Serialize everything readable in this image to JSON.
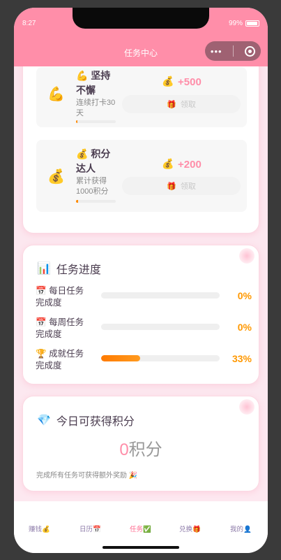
{
  "status": {
    "time": "8:27",
    "battery": "99%"
  },
  "navbar": {
    "title": "任务中心",
    "capsule_more": "•••",
    "capsule_close_icon": "target-icon"
  },
  "achievements": [
    {
      "icon": "💪",
      "emoji": "💪",
      "name": "坚持不懈",
      "desc": "连续打卡30天",
      "progress": 0.03,
      "reward_icon": "💰",
      "points": "+500",
      "claim_icon": "🎁",
      "claim": "领取"
    },
    {
      "icon": "💰",
      "emoji": "💰",
      "name": "积分达人",
      "desc": "累计获得1000积分",
      "progress": 0.05,
      "reward_icon": "💰",
      "points": "+200",
      "claim_icon": "🎁",
      "claim": "领取"
    }
  ],
  "progress_section": {
    "icon": "📊",
    "title": "任务进度",
    "rows": [
      {
        "icon": "📅",
        "label": "每日任务完成度",
        "percent": 0,
        "percent_label": "0%"
      },
      {
        "icon": "📅",
        "label": "每周任务完成度",
        "percent": 0,
        "percent_label": "0%"
      },
      {
        "icon": "🏆",
        "label": "成就任务完成度",
        "percent": 33,
        "percent_label": "33%"
      }
    ]
  },
  "points_today": {
    "icon": "💎",
    "title": "今日可获得积分",
    "value": "0",
    "unit": "积分",
    "note": "完成所有任务可获得额外奖励",
    "note_icon": "🎉"
  },
  "tabbar": [
    {
      "label": "赚钱",
      "icon": "💰",
      "active": false
    },
    {
      "label": "日历",
      "icon": "📅",
      "active": false
    },
    {
      "label": "任务",
      "icon": "✅",
      "active": true
    },
    {
      "label": "兑换",
      "icon": "🎁",
      "active": false
    },
    {
      "label": "我的",
      "icon": "👤",
      "active": false
    }
  ],
  "colors": {
    "brand": "#ff8ea9",
    "accent_orange": "#ff9800",
    "points_pink": "#ff8ea9"
  }
}
